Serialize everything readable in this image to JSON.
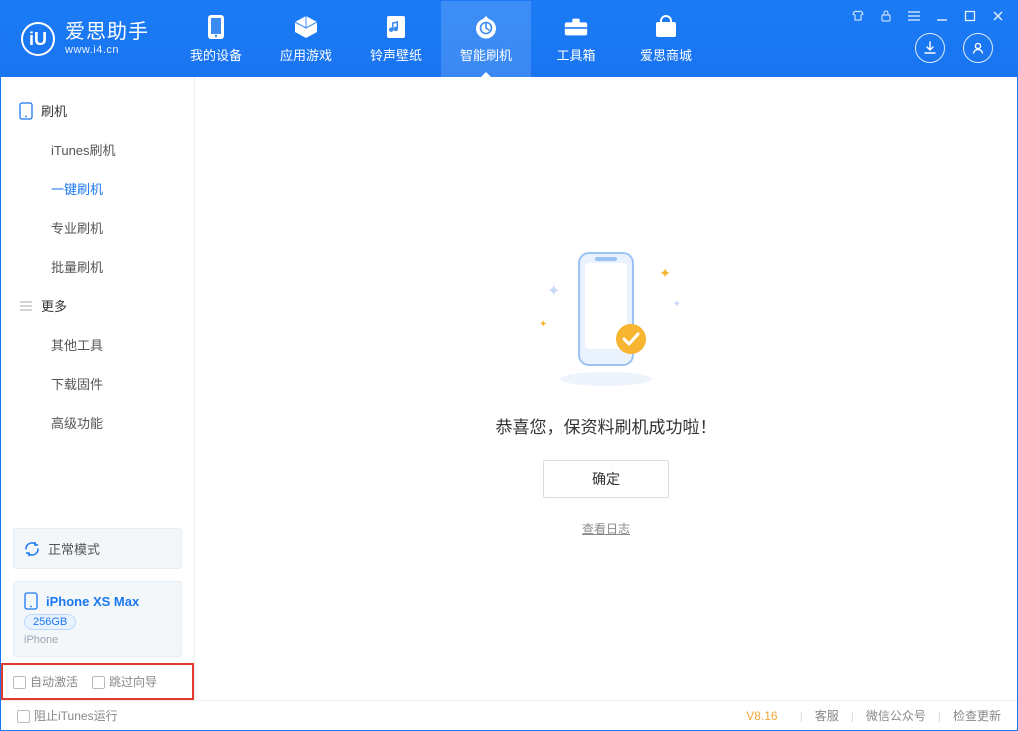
{
  "brand": {
    "title": "爱思助手",
    "subtitle": "www.i4.cn",
    "logo_letter": "iU"
  },
  "nav": [
    {
      "label": "我的设备",
      "icon": "device-icon"
    },
    {
      "label": "应用游戏",
      "icon": "apps-icon"
    },
    {
      "label": "铃声壁纸",
      "icon": "music-icon"
    },
    {
      "label": "智能刷机",
      "icon": "flash-icon",
      "active": true
    },
    {
      "label": "工具箱",
      "icon": "toolbox-icon"
    },
    {
      "label": "爱思商城",
      "icon": "shop-icon"
    }
  ],
  "sidebar": {
    "group1": {
      "title": "刷机",
      "icon": "phone-outline-icon",
      "items": [
        {
          "label": "iTunes刷机"
        },
        {
          "label": "一键刷机",
          "active": true
        },
        {
          "label": "专业刷机"
        },
        {
          "label": "批量刷机"
        }
      ]
    },
    "group2": {
      "title": "更多",
      "icon": "list-icon",
      "items": [
        {
          "label": "其他工具"
        },
        {
          "label": "下载固件"
        },
        {
          "label": "高级功能"
        }
      ]
    },
    "mode": {
      "label": "正常模式"
    },
    "device": {
      "name": "iPhone XS Max",
      "storage": "256GB",
      "type": "iPhone"
    },
    "checkboxes": {
      "auto_activate": "自动激活",
      "skip_guide": "跳过向导"
    }
  },
  "main": {
    "success_text": "恭喜您，保资料刷机成功啦！",
    "ok_label": "确定",
    "log_link": "查看日志"
  },
  "footer": {
    "block_itunes": "阻止iTunes运行",
    "version": "V8.16",
    "links": {
      "service": "客服",
      "wechat": "微信公众号",
      "update": "检查更新"
    }
  }
}
